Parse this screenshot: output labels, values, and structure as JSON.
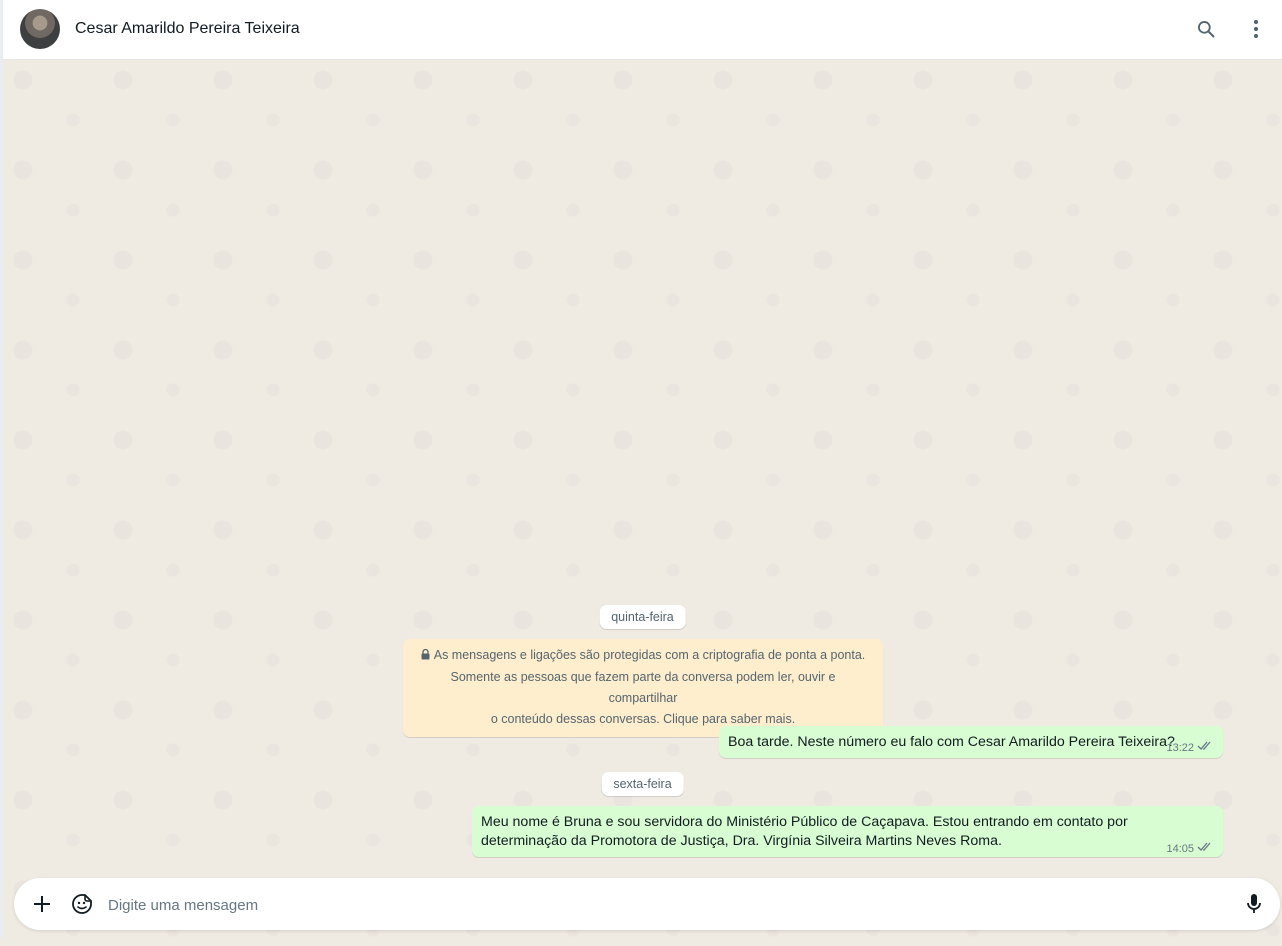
{
  "header": {
    "contact_name": "Cesar Amarildo Pereira Teixeira",
    "avatar_icon": "contact-avatar",
    "search_icon": "search-icon",
    "menu_icon": "more-vertical-icon"
  },
  "chat": {
    "date_1": "quinta-feira",
    "encryption_notice": {
      "icon": "lock-icon",
      "line1": "As mensagens e ligações são protegidas com a criptografia de ponta a ponta.",
      "line2": "Somente as pessoas que fazem parte da conversa podem ler, ouvir e compartilhar",
      "line3": "o conteúdo dessas conversas. Clique para saber mais."
    },
    "messages": [
      {
        "text": "Boa tarde. Neste número eu falo com Cesar Amarildo Pereira Teixeira?",
        "time": "13:22",
        "status": "read-double-check"
      },
      {
        "text": "Meu nome é Bruna e sou servidora do Ministério Público de Caçapava. Estou entrando em contato por determinação da Promotora de Justiça, Dra. Virgínia Silveira Martins Neves Roma.",
        "time": "14:05",
        "status": "read-double-check"
      }
    ],
    "date_2": "sexta-feira"
  },
  "composer": {
    "placeholder": "Digite uma mensagem",
    "attach_icon": "plus-icon",
    "sticker_icon": "sticker-icon",
    "mic_icon": "microphone-icon"
  },
  "colors": {
    "outgoing_bubble": "#d9fdd3",
    "chat_background": "#efeae2",
    "notice_background": "#ffeecd"
  }
}
